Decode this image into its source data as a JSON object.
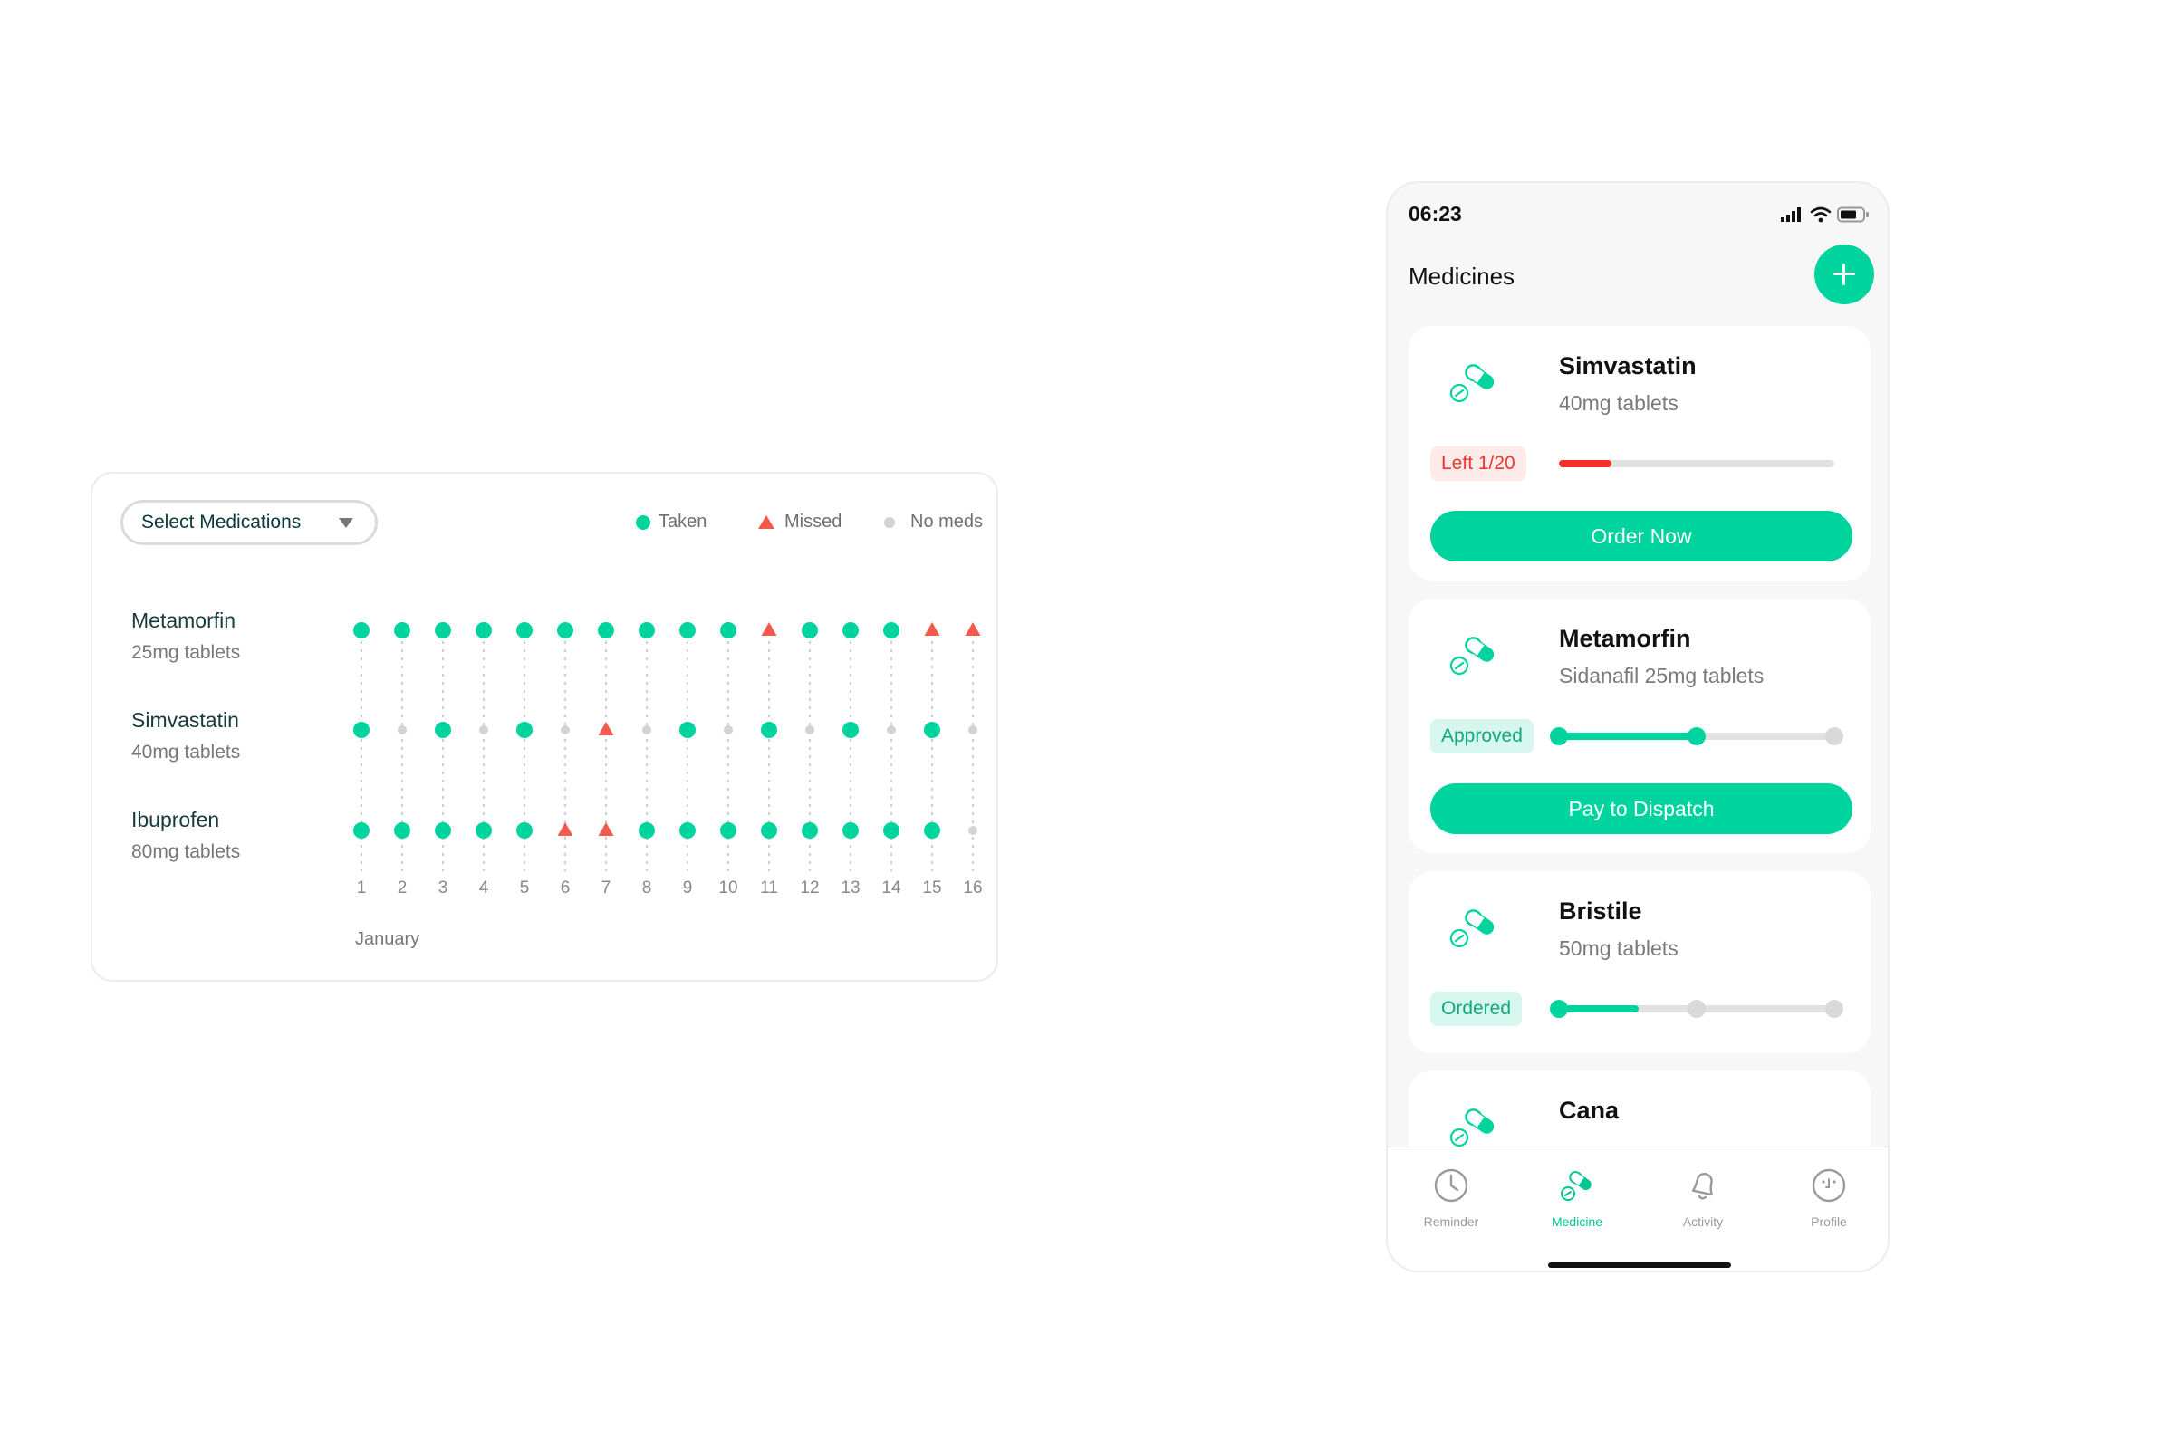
{
  "tracker": {
    "select_label": "Select Medications",
    "legend": {
      "taken": "Taken",
      "missed": "Missed",
      "no_meds": "No meds"
    },
    "month": "January",
    "days": [
      "1",
      "2",
      "3",
      "4",
      "5",
      "6",
      "7",
      "8",
      "9",
      "10",
      "11",
      "12",
      "13",
      "14",
      "15",
      "16"
    ],
    "colors": {
      "taken": "#00d49e",
      "missed": "#f25a4b",
      "no_meds": "#d3d3d3"
    },
    "medications": [
      {
        "name": "Metamorfin",
        "dose": "25mg tablets",
        "status": [
          "taken",
          "taken",
          "taken",
          "taken",
          "taken",
          "taken",
          "taken",
          "taken",
          "taken",
          "taken",
          "missed",
          "taken",
          "taken",
          "taken",
          "missed",
          "missed"
        ]
      },
      {
        "name": "Simvastatin",
        "dose": "40mg tablets",
        "status": [
          "taken",
          "none",
          "taken",
          "none",
          "taken",
          "none",
          "missed",
          "none",
          "taken",
          "none",
          "taken",
          "none",
          "taken",
          "none",
          "taken",
          "none"
        ]
      },
      {
        "name": "Ibuprofen",
        "dose": "80mg tablets",
        "status": [
          "taken",
          "taken",
          "taken",
          "taken",
          "taken",
          "missed",
          "missed",
          "taken",
          "taken",
          "taken",
          "taken",
          "taken",
          "taken",
          "taken",
          "taken",
          "none"
        ]
      }
    ]
  },
  "phone": {
    "time": "06:23",
    "title": "Medicines",
    "cards": [
      {
        "name": "Simvastatin",
        "dose": "40mg tablets",
        "badge": "Left 1/20",
        "badge_style": "red",
        "progress_type": "bar",
        "progress": 0.19,
        "cta": "Order Now"
      },
      {
        "name": "Metamorfin",
        "dose": "Sidanafil 25mg tablets",
        "badge": "Approved",
        "badge_style": "green",
        "progress_type": "steps",
        "step": 2,
        "progress": 0.5,
        "cta": "Pay to Dispatch"
      },
      {
        "name": "Bristile",
        "dose": "50mg tablets",
        "badge": "Ordered",
        "badge_style": "green",
        "progress_type": "steps",
        "step": 1,
        "progress": 0.29
      },
      {
        "name": "Cana"
      }
    ],
    "tabs": [
      {
        "label": "Reminder",
        "icon": "clock-icon",
        "active": false
      },
      {
        "label": "Medicine",
        "icon": "pill-icon",
        "active": true
      },
      {
        "label": "Activity",
        "icon": "bell-icon",
        "active": false
      },
      {
        "label": "Profile",
        "icon": "face-icon",
        "active": false
      }
    ],
    "accent": "#00d49e"
  }
}
